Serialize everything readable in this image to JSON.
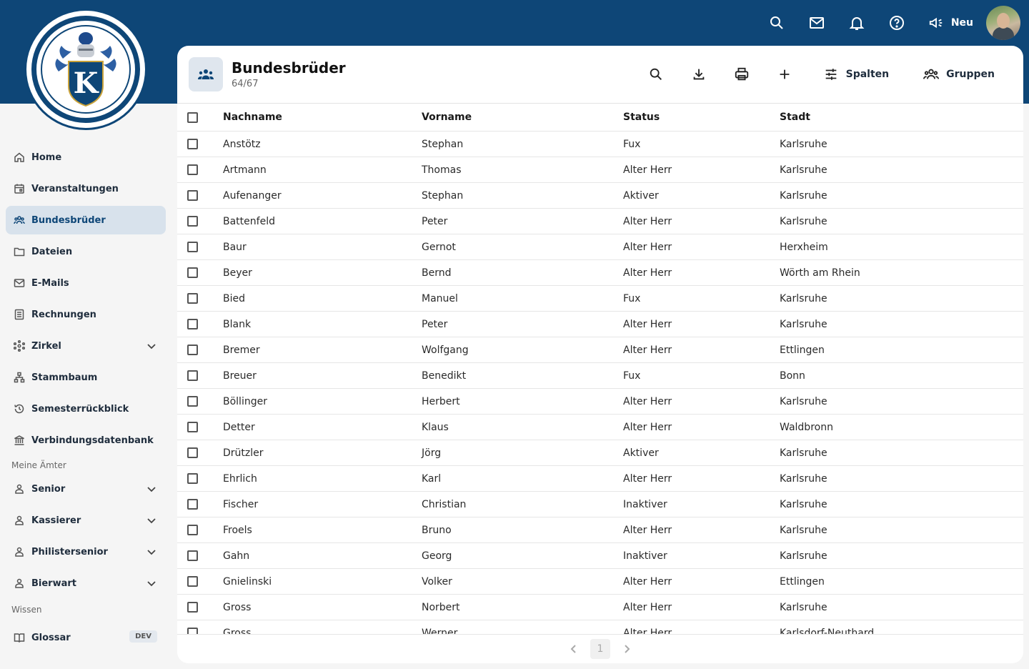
{
  "topbar": {
    "icons": [
      "search-icon",
      "mail-icon",
      "bell-icon",
      "help-icon"
    ],
    "new_label": "Neu"
  },
  "sidebar": {
    "items": [
      {
        "label": "Home",
        "icon": "home-icon"
      },
      {
        "label": "Veranstaltungen",
        "icon": "calendar-icon"
      },
      {
        "label": "Bundesbrüder",
        "icon": "group-icon",
        "active": true
      },
      {
        "label": "Dateien",
        "icon": "folder-icon"
      },
      {
        "label": "E-Mails",
        "icon": "mail-icon"
      },
      {
        "label": "Rechnungen",
        "icon": "receipt-icon"
      },
      {
        "label": "Zirkel",
        "icon": "network-icon",
        "expandable": true
      },
      {
        "label": "Stammbaum",
        "icon": "tree-icon"
      },
      {
        "label": "Semesterrückblick",
        "icon": "history-icon"
      },
      {
        "label": "Verbindungsdatenbank",
        "icon": "bank-icon"
      }
    ],
    "section_aemter": "Meine Ämter",
    "aemter": [
      {
        "label": "Senior"
      },
      {
        "label": "Kassierer"
      },
      {
        "label": "Philistersenior"
      },
      {
        "label": "Bierwart"
      }
    ],
    "section_wissen": "Wissen",
    "wissen": [
      {
        "label": "Glossar",
        "badge": "DEV"
      }
    ]
  },
  "panel": {
    "title": "Bundesbrüder",
    "count": "64/67",
    "columns_label": "Spalten",
    "groups_label": "Gruppen"
  },
  "table": {
    "headers": [
      "Nachname",
      "Vorname",
      "Status",
      "Stadt"
    ],
    "rows": [
      [
        "Anstötz",
        "Stephan",
        "Fux",
        "Karlsruhe"
      ],
      [
        "Artmann",
        "Thomas",
        "Alter Herr",
        "Karlsruhe"
      ],
      [
        "Aufenanger",
        "Stephan",
        "Aktiver",
        "Karlsruhe"
      ],
      [
        "Battenfeld",
        "Peter",
        "Alter Herr",
        "Karlsruhe"
      ],
      [
        "Baur",
        "Gernot",
        "Alter Herr",
        "Herxheim"
      ],
      [
        "Beyer",
        "Bernd",
        "Alter Herr",
        "Wörth am Rhein"
      ],
      [
        "Bied",
        "Manuel",
        "Fux",
        "Karlsruhe"
      ],
      [
        "Blank",
        "Peter",
        "Alter Herr",
        "Karlsruhe"
      ],
      [
        "Bremer",
        "Wolfgang",
        "Alter Herr",
        "Ettlingen"
      ],
      [
        "Breuer",
        "Benedikt",
        "Fux",
        "Bonn"
      ],
      [
        "Böllinger",
        "Herbert",
        "Alter Herr",
        "Karlsruhe"
      ],
      [
        "Detter",
        "Klaus",
        "Alter Herr",
        "Waldbronn"
      ],
      [
        "Drützler",
        "Jörg",
        "Aktiver",
        "Karlsruhe"
      ],
      [
        "Ehrlich",
        "Karl",
        "Alter Herr",
        "Karlsruhe"
      ],
      [
        "Fischer",
        "Christian",
        "Inaktiver",
        "Karlsruhe"
      ],
      [
        "Froels",
        "Bruno",
        "Alter Herr",
        "Karlsruhe"
      ],
      [
        "Gahn",
        "Georg",
        "Inaktiver",
        "Karlsruhe"
      ],
      [
        "Gnielinski",
        "Volker",
        "Alter Herr",
        "Ettlingen"
      ],
      [
        "Gross",
        "Norbert",
        "Alter Herr",
        "Karlsruhe"
      ],
      [
        "Gross",
        "Werner",
        "Alter Herr",
        "Karlsdorf-Neuthard"
      ]
    ]
  },
  "pager": {
    "page": "1"
  },
  "colors": {
    "brand": "#0e4677",
    "active_bg": "#d8e2ec"
  }
}
